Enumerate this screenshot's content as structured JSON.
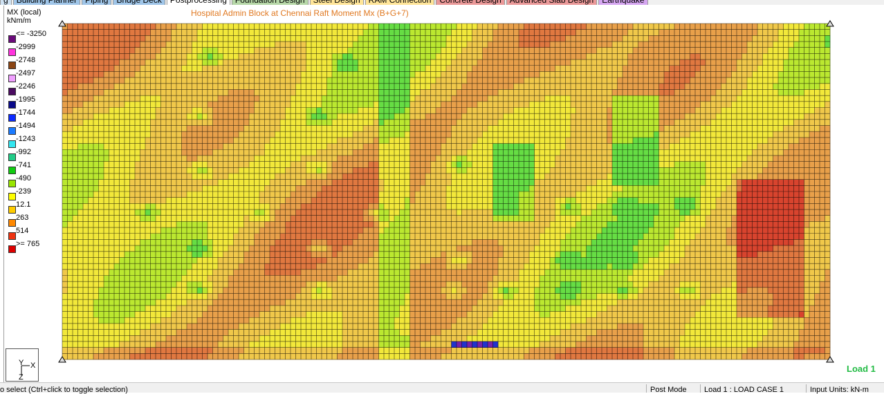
{
  "tabs": [
    {
      "label": "g",
      "color": "#cfe2f3"
    },
    {
      "label": "Building Planner",
      "color": "#9fc5e8"
    },
    {
      "label": "Piping",
      "color": "#9fc5e8"
    },
    {
      "label": "Bridge Deck",
      "color": "#9fc5e8"
    },
    {
      "label": "Postprocessing",
      "color": "#ffffff"
    },
    {
      "label": "Foundation Design",
      "color": "#b6d7a8"
    },
    {
      "label": "Steel Design",
      "color": "#ffe599"
    },
    {
      "label": "RAM Connection",
      "color": "#ffe599"
    },
    {
      "label": "Concrete Design",
      "color": "#ea9999"
    },
    {
      "label": "Advanced Slab Design",
      "color": "#ea9999"
    },
    {
      "label": "Earthquake",
      "color": "#d5a6f0"
    }
  ],
  "legend": {
    "title_line1": "MX (local)",
    "title_line2": "kNm/m",
    "entries": [
      {
        "label": "<= -3250",
        "color": "#6a0a7a"
      },
      {
        "label": "-2999",
        "color": "#ff33dd"
      },
      {
        "label": "-2748",
        "color": "#8b4513"
      },
      {
        "label": "-2497",
        "color": "#f0a0ff"
      },
      {
        "label": "-2246",
        "color": "#4a0a60"
      },
      {
        "label": "-1995",
        "color": "#0a0a8a"
      },
      {
        "label": "-1744",
        "color": "#0a2aff"
      },
      {
        "label": "-1494",
        "color": "#1a7aff"
      },
      {
        "label": "-1243",
        "color": "#33e6f0"
      },
      {
        "label": "-992",
        "color": "#22cc88"
      },
      {
        "label": "-741",
        "color": "#11cc11"
      },
      {
        "label": "-490",
        "color": "#99e600"
      },
      {
        "label": "-239",
        "color": "#ffff00"
      },
      {
        "label": "12.1",
        "color": "#ffcc00"
      },
      {
        "label": "263",
        "color": "#ff8800"
      },
      {
        "label": "514",
        "color": "#ee3311"
      },
      {
        "label": ">= 765",
        "color": "#dd0000"
      }
    ]
  },
  "plot_title": "Hospital Admin Block at Chennai  Raft Moment Mx (B+G+7)",
  "axis_labels": {
    "y": "Y",
    "x": "X",
    "z": "Z"
  },
  "load_label": "Load 1",
  "status": {
    "hint": "o select (Ctrl+click to toggle selection)",
    "mode": "Post Mode",
    "load": "Load 1 : LOAD CASE 1",
    "units": "Input Units:  kN-m"
  }
}
